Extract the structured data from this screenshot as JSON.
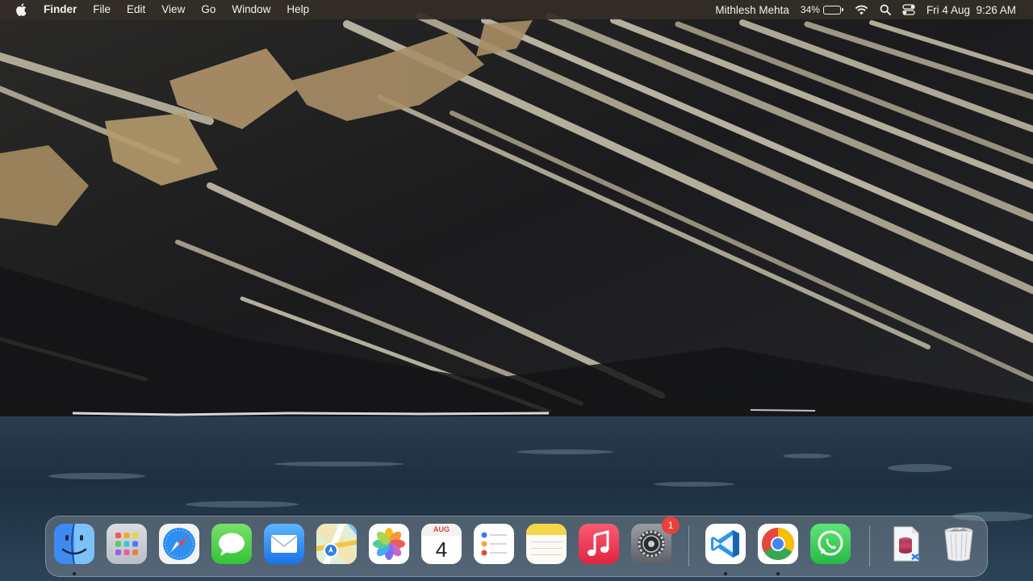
{
  "menubar": {
    "app_name": "Finder",
    "menus": [
      "File",
      "Edit",
      "View",
      "Go",
      "Window",
      "Help"
    ],
    "user_name": "Mithlesh Mehta",
    "battery_percent": "34%",
    "battery_level": 0.34,
    "datetime": "Fri 4 Aug  9:26 AM",
    "icons": [
      "apple-logo-icon",
      "battery-icon",
      "wifi-icon",
      "search-icon",
      "control-center-icon"
    ]
  },
  "dock": {
    "apps": [
      {
        "name": "Finder",
        "icon": "finder-icon",
        "running": true
      },
      {
        "name": "Launchpad",
        "icon": "launchpad-icon",
        "running": false
      },
      {
        "name": "Safari",
        "icon": "safari-icon",
        "running": false
      },
      {
        "name": "Messages",
        "icon": "messages-icon",
        "running": false
      },
      {
        "name": "Mail",
        "icon": "mail-icon",
        "running": false
      },
      {
        "name": "Maps",
        "icon": "maps-icon",
        "running": false
      },
      {
        "name": "Photos",
        "icon": "photos-icon",
        "running": false
      },
      {
        "name": "Calendar",
        "icon": "calendar-icon",
        "running": false
      },
      {
        "name": "Reminders",
        "icon": "reminders-icon",
        "running": false
      },
      {
        "name": "Notes",
        "icon": "notes-icon",
        "running": false
      },
      {
        "name": "Music",
        "icon": "music-icon",
        "running": false
      },
      {
        "name": "System Settings",
        "icon": "settings-icon",
        "running": false,
        "badge": "1"
      },
      {
        "name": "Visual Studio Code",
        "icon": "vscode-icon",
        "running": true
      },
      {
        "name": "Google Chrome",
        "icon": "chrome-icon",
        "running": true
      },
      {
        "name": "WhatsApp",
        "icon": "whatsapp-icon",
        "running": false
      },
      {
        "name": "Database Document",
        "icon": "database-document-icon",
        "running": false
      },
      {
        "name": "Trash",
        "icon": "trash-icon",
        "running": false
      }
    ],
    "calendar": {
      "month": "AUG",
      "day": "4"
    },
    "settings_badge": "1"
  },
  "colors": {
    "menubar_bg": "#342e28",
    "sea": "#1f3142",
    "rock_dark": "#1c1c1f",
    "rock_light": "#cfc8b3",
    "rock_tan": "#b0956a",
    "badge": "#e8403a"
  }
}
